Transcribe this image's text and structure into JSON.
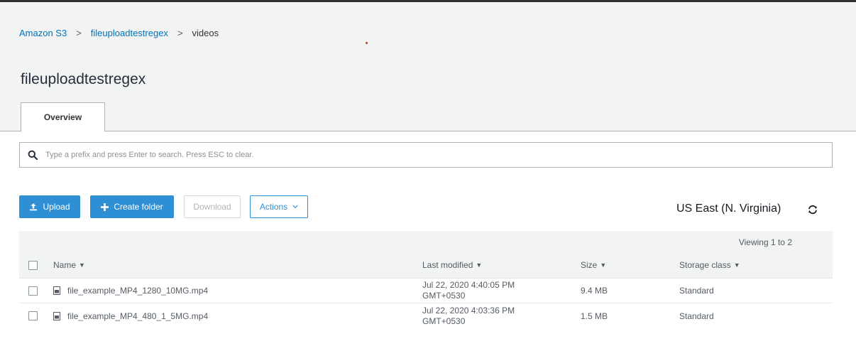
{
  "breadcrumb": {
    "items": [
      "Amazon S3",
      "fileuploadtestregex",
      "videos"
    ],
    "separator": ">"
  },
  "bucket_title": "fileuploadtestregex",
  "tabs": [
    {
      "label": "Overview"
    }
  ],
  "search": {
    "placeholder": "Type a prefix and press Enter to search. Press ESC to clear."
  },
  "toolbar": {
    "upload_label": "Upload",
    "create_folder_label": "Create folder",
    "download_label": "Download",
    "actions_label": "Actions"
  },
  "region": "US East (N. Virginia)",
  "viewing_text": "Viewing 1 to 2",
  "table": {
    "columns": [
      "Name",
      "Last modified",
      "Size",
      "Storage class"
    ],
    "rows": [
      {
        "name": "file_example_MP4_1280_10MG.mp4",
        "modified_line1": "Jul 22, 2020 4:40:05 PM",
        "modified_line2": "GMT+0530",
        "size": "9.4 MB",
        "storage_class": "Standard"
      },
      {
        "name": "file_example_MP4_480_1_5MG.mp4",
        "modified_line1": "Jul 22, 2020 4:03:36 PM",
        "modified_line2": "GMT+0530",
        "size": "1.5 MB",
        "storage_class": "Standard"
      }
    ]
  },
  "colors": {
    "primary": "#2f8fd5",
    "link": "#0073bb",
    "page_bg": "#f2f3f3"
  },
  "icons": [
    "search-icon",
    "upload-icon",
    "plus-icon",
    "chevron-down-icon",
    "refresh-icon",
    "file-icon"
  ]
}
